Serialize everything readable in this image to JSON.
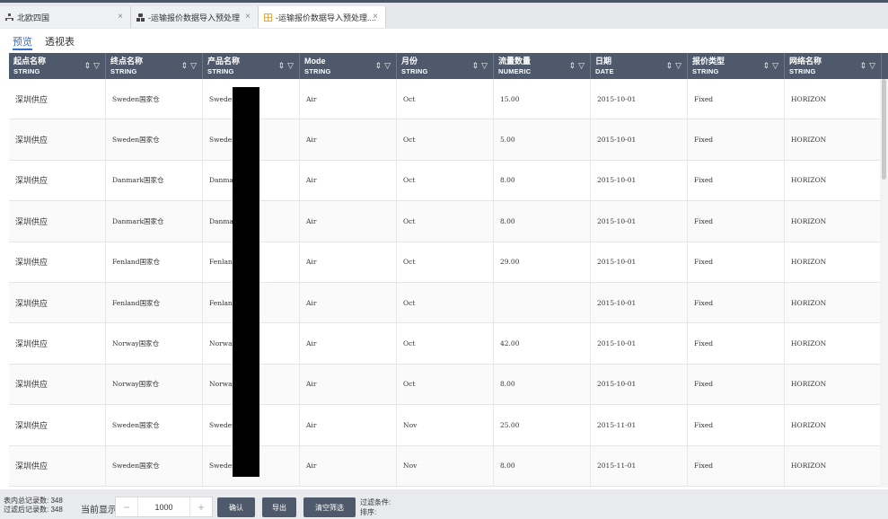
{
  "tabs": [
    {
      "label": "北欧四国",
      "icon": "sitemap-icon",
      "active": false
    },
    {
      "label": "-运输报价数据导入预处理",
      "icon": "cubes-icon",
      "active": false
    },
    {
      "label": "-运输报价数据导入预处理....",
      "icon": "table-icon",
      "active": true
    }
  ],
  "view_tabs": {
    "preview": "预览",
    "pivot": "透视表"
  },
  "columns": [
    {
      "name": "起点名称",
      "type": "STRING"
    },
    {
      "name": "终点名称",
      "type": "STRING"
    },
    {
      "name": "产品名称",
      "type": "STRING"
    },
    {
      "name": "Mode",
      "type": "STRING"
    },
    {
      "name": "月份",
      "type": "STRING"
    },
    {
      "name": "流量数量",
      "type": "NUMERIC"
    },
    {
      "name": "日期",
      "type": "DATE"
    },
    {
      "name": "报价类型",
      "type": "STRING"
    },
    {
      "name": "网络名称",
      "type": "STRING"
    }
  ],
  "header_icons": {
    "sort": "⇕",
    "filter": "▽"
  },
  "rows": [
    [
      "深圳供应",
      "Sweden国家仓",
      "Sweden_",
      "Air",
      "Oct",
      "15.00",
      "2015-10-01",
      "Fixed",
      "HORIZON"
    ],
    [
      "深圳供应",
      "Sweden国家仓",
      "Sweden_",
      "Air",
      "Oct",
      "5.00",
      "2015-10-01",
      "Fixed",
      "HORIZON"
    ],
    [
      "深圳供应",
      "Danmark国家仓",
      "Danmark",
      "Air",
      "Oct",
      "8.00",
      "2015-10-01",
      "Fixed",
      "HORIZON"
    ],
    [
      "深圳供应",
      "Danmark国家仓",
      "Danmark",
      "Air",
      "Oct",
      "8.00",
      "2015-10-01",
      "Fixed",
      "HORIZON"
    ],
    [
      "深圳供应",
      "Fenland国家仓",
      "Fenland",
      "Air",
      "Oct",
      "29.00",
      "2015-10-01",
      "Fixed",
      "HORIZON"
    ],
    [
      "深圳供应",
      "Fenland国家仓",
      "Fenland",
      "Air",
      "Oct",
      "",
      "2015-10-01",
      "Fixed",
      "HORIZON"
    ],
    [
      "深圳供应",
      "Norway国家仓",
      "Norway_",
      "Air",
      "Oct",
      "42.00",
      "2015-10-01",
      "Fixed",
      "HORIZON"
    ],
    [
      "深圳供应",
      "Norway国家仓",
      "Norway_",
      "Air",
      "Oct",
      "8.00",
      "2015-10-01",
      "Fixed",
      "HORIZON"
    ],
    [
      "深圳供应",
      "Sweden国家仓",
      "Sweden_",
      "Air",
      "Nov",
      "25.00",
      "2015-11-01",
      "Fixed",
      "HORIZON"
    ],
    [
      "深圳供应",
      "Sweden国家仓",
      "Sweden_",
      "Air",
      "Nov",
      "8.00",
      "2015-11-01",
      "Fixed",
      "HORIZON"
    ]
  ],
  "footer": {
    "total_label": "表内总记录数:",
    "total_value": "348",
    "filtered_label": "过滤后记录数:",
    "filtered_value": "348",
    "current_show_label": "当前显示",
    "minus": "−",
    "current_show_value": "1000",
    "plus": "+",
    "confirm_label": "确认",
    "export_label": "导出",
    "clear_filter_label": "清空筛选",
    "filter_cond_label": "过滤条件:",
    "sort_label": "排序:"
  }
}
